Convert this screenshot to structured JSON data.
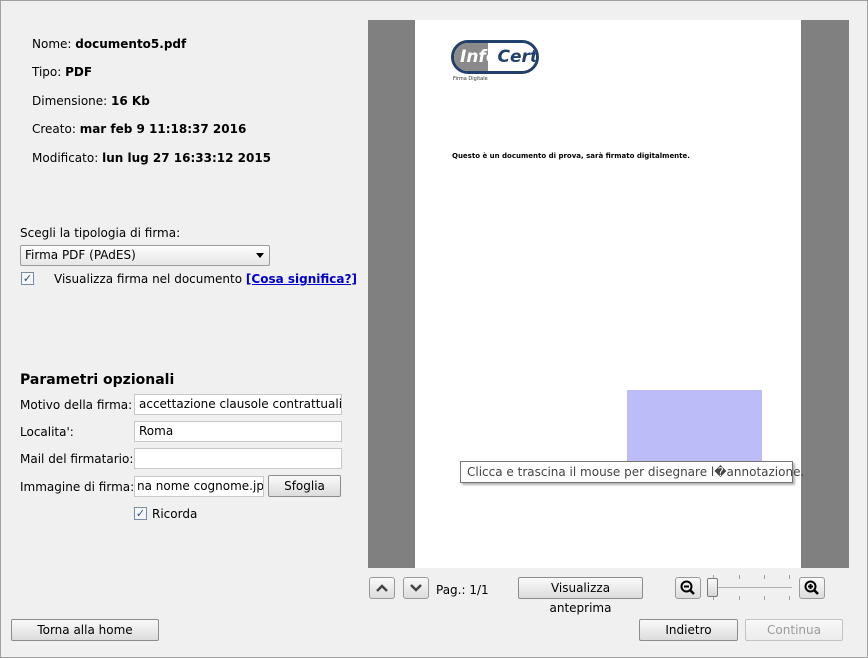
{
  "file_info": {
    "name_label": "Nome:",
    "name_value": "documento5.pdf",
    "type_label": "Tipo:",
    "type_value": "PDF",
    "size_label": "Dimensione:",
    "size_value": "16 Kb",
    "created_label": "Creato:",
    "created_value": "mar feb 9 11:18:37 2016",
    "modified_label": "Modificato:",
    "modified_value": "lun lug 27 16:33:12 2015"
  },
  "signature_type": {
    "label": "Scegli la tipologia di firma:",
    "selected": "Firma PDF (PAdES)",
    "show_in_doc_label": "Visualizza firma nel documento",
    "show_in_doc_checked": true,
    "what_means_link": "[Cosa significa?]"
  },
  "optional_params": {
    "title": "Parametri opzionali",
    "reason_label": "Motivo della firma:",
    "reason_value": "accettazione clausole contrattuali",
    "location_label": "Localita':",
    "location_value": "Roma",
    "email_label": "Mail del firmatario:",
    "email_value": "",
    "image_label": "Immagine di firma:",
    "image_value": "na nome cognome.jpg",
    "browse_button": "Sfoglia",
    "remember_label": "Ricorda",
    "remember_checked": true
  },
  "preview": {
    "logo_info": "Info",
    "logo_cert": "Cert",
    "logo_subtitle": "Firma Digitale",
    "document_text": "Questo è un documento di prova, sarà firmato digitalmente.",
    "tooltip": "Clicca e trascina il mouse per disegnare l�annotazione."
  },
  "preview_controls": {
    "page_label": "Pag.: 1/1",
    "preview_button": "Visualizza anteprima",
    "up_icon": "chevron-up-icon",
    "down_icon": "chevron-down-icon",
    "zoom_out_icon": "zoom-out-icon",
    "zoom_in_icon": "zoom-in-icon",
    "zoom_level": 0
  },
  "footer": {
    "home_button": "Torna alla home",
    "back_button": "Indietro",
    "continue_button": "Continua"
  },
  "colors": {
    "preview_bg": "#808080",
    "signature_box": "#bcbcf8",
    "link": "#0000cc",
    "logo_blue": "#22406d"
  }
}
